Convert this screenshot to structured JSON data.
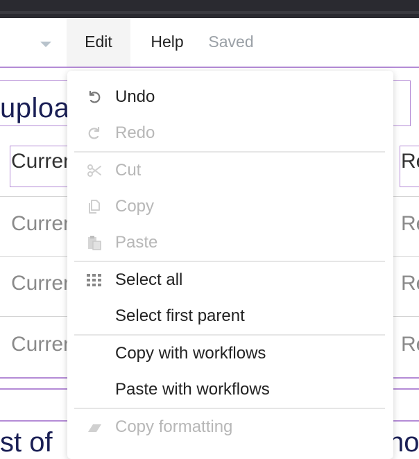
{
  "menubar": {
    "edit_label": "Edit",
    "help_label": "Help",
    "status_label": "Saved"
  },
  "background": {
    "upload_title": "uploa",
    "row_left": "Curren",
    "row_right": "Re",
    "bottom_left": "st of",
    "bottom_right": "no"
  },
  "edit_menu": {
    "undo": "Undo",
    "redo": "Redo",
    "cut": "Cut",
    "copy": "Copy",
    "paste": "Paste",
    "select_all": "Select all",
    "select_first_parent": "Select first parent",
    "copy_with_workflows": "Copy with workflows",
    "paste_with_workflows": "Paste with workflows",
    "copy_formatting": "Copy formatting"
  },
  "icons": {
    "undo": "undo-icon",
    "redo": "redo-icon",
    "cut": "scissors-icon",
    "copy": "copy-icon",
    "paste": "clipboard-icon",
    "select_all": "grid-icon",
    "copy_formatting": "eraser-icon"
  }
}
